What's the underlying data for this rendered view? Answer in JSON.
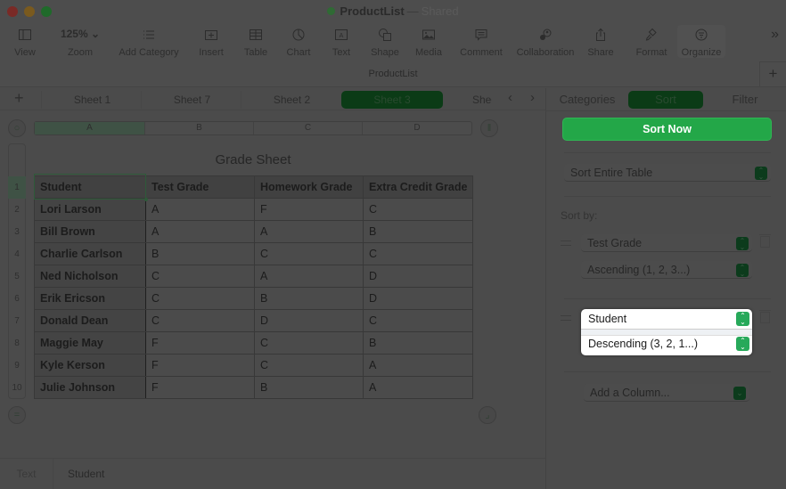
{
  "window": {
    "title": "ProductList",
    "title_separator": "—",
    "status": "Shared",
    "subtitle": "ProductList"
  },
  "toolbar": {
    "items": [
      {
        "id": "view",
        "label": "View",
        "icon": "sidebar-icon"
      },
      {
        "id": "zoom",
        "label": "Zoom",
        "value": "125%",
        "icon": "chevron-down-icon"
      },
      {
        "id": "add-category",
        "label": "Add Category",
        "icon": "list-icon"
      },
      {
        "id": "insert",
        "label": "Insert",
        "icon": "insert-icon"
      },
      {
        "id": "table",
        "label": "Table",
        "icon": "table-icon"
      },
      {
        "id": "chart",
        "label": "Chart",
        "icon": "chart-icon"
      },
      {
        "id": "text",
        "label": "Text",
        "icon": "text-icon"
      },
      {
        "id": "shape",
        "label": "Shape",
        "icon": "shape-icon"
      },
      {
        "id": "media",
        "label": "Media",
        "icon": "media-icon"
      },
      {
        "id": "comment",
        "label": "Comment",
        "icon": "comment-icon"
      },
      {
        "id": "collaboration",
        "label": "Collaboration",
        "icon": "collaboration-icon"
      },
      {
        "id": "share",
        "label": "Share",
        "icon": "share-icon"
      },
      {
        "id": "format",
        "label": "Format",
        "icon": "paintbrush-icon"
      },
      {
        "id": "organize",
        "label": "Organize",
        "icon": "organize-icon"
      }
    ],
    "more": "»",
    "add": "+"
  },
  "sheets": {
    "add": "+",
    "tabs": [
      "Sheet 1",
      "Sheet 7",
      "Sheet 2",
      "Sheet 3",
      "Sheet"
    ],
    "active": "Sheet 3",
    "prev": "‹",
    "next": "›"
  },
  "table": {
    "title": "Grade Sheet",
    "column_letters": [
      "A",
      "B",
      "C",
      "D"
    ],
    "row_numbers": [
      "1",
      "2",
      "3",
      "4",
      "5",
      "6",
      "7",
      "8",
      "9",
      "10"
    ],
    "headers": [
      "Student",
      "Test Grade",
      "Homework Grade",
      "Extra Credit Grade"
    ],
    "rows": [
      [
        "Lori Larson",
        "A",
        "F",
        "C"
      ],
      [
        "Bill Brown",
        "A",
        "A",
        "B"
      ],
      [
        "Charlie Carlson",
        "B",
        "C",
        "C"
      ],
      [
        "Ned Nicholson",
        "C",
        "A",
        "D"
      ],
      [
        "Erik Ericson",
        "C",
        "B",
        "D"
      ],
      [
        "Donald Dean",
        "C",
        "D",
        "C"
      ],
      [
        "Maggie May",
        "F",
        "C",
        "B"
      ],
      [
        "Kyle Kerson",
        "F",
        "C",
        "A"
      ],
      [
        "Julie Johnson",
        "F",
        "B",
        "A"
      ]
    ]
  },
  "statusbar": {
    "type": "Text",
    "value": "Student"
  },
  "sidebar": {
    "tabs": [
      "Categories",
      "Sort",
      "Filter"
    ],
    "active_tab": "Sort",
    "sort_now": "Sort Now",
    "scope": "Sort Entire Table",
    "sort_by_label": "Sort by:",
    "rules": [
      {
        "column": "Test Grade",
        "order": "Ascending (1, 2, 3...)"
      },
      {
        "column": "Student",
        "order": "Descending (3, 2, 1...)"
      }
    ],
    "add_column": "Add a Column..."
  },
  "colors": {
    "accent_green": "#23a748",
    "active_tab_green": "#0b3b16",
    "stepper_green": "#27a95a",
    "overlay_gray": "#4b4b4b"
  }
}
